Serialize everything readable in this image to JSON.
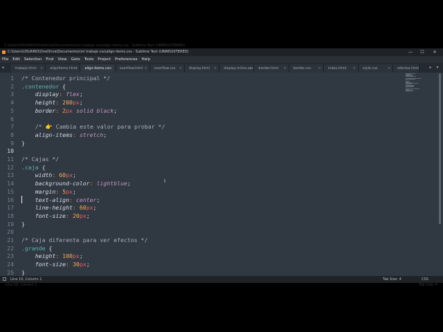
{
  "ghost": {
    "top_text": "C:\\Users\\USUARIO\\OneDrive\\Documentos\\mi trabajo css\\align-items.css - Sublime Text (UNREGISTERED)",
    "bottom_left": "Line 10, Column 1",
    "bottom_right": "Tab Size: 4"
  },
  "window": {
    "title": "C:\\Users\\USUARIO\\OneDrive\\Documentos\\mi trabajo css\\align-items.css - Sublime Text (UNREGISTERED)",
    "controls": {
      "minimize": "—",
      "maximize": "☐",
      "close": "✕"
    }
  },
  "menu": [
    "File",
    "Edit",
    "Selection",
    "Find",
    "View",
    "Goto",
    "Tools",
    "Project",
    "Preferences",
    "Help"
  ],
  "tabs": [
    {
      "label": "trabajo.html",
      "active": false
    },
    {
      "label": "alignItems.html",
      "active": false
    },
    {
      "label": "align-items.css",
      "active": true
    },
    {
      "label": "overflow.html",
      "active": false
    },
    {
      "label": "overflow.css",
      "active": false
    },
    {
      "label": "display.html",
      "active": false
    },
    {
      "label": "display-inline.css",
      "active": false
    },
    {
      "label": "border.html",
      "active": false
    },
    {
      "label": "border.css",
      "active": false
    },
    {
      "label": "index.html",
      "active": false
    },
    {
      "label": "style.css",
      "active": false
    },
    {
      "label": "efectos.html",
      "active": false
    }
  ],
  "tab_close": "×",
  "tab_arrows": {
    "left": "◂",
    "right": "▸",
    "more": "▾"
  },
  "editor": {
    "current_line": 10,
    "lines": [
      [
        [
          "cm",
          "/* Contenedor principal */"
        ]
      ],
      [
        [
          "sel",
          ".contenedor"
        ],
        [
          "br",
          " {"
        ]
      ],
      [
        [
          "ws",
          "    "
        ],
        [
          "prop",
          "display"
        ],
        [
          "colon",
          ":"
        ],
        [
          "ws",
          " "
        ],
        [
          "kw",
          "flex"
        ],
        [
          "semi",
          ";"
        ]
      ],
      [
        [
          "ws",
          "    "
        ],
        [
          "prop",
          "height"
        ],
        [
          "colon",
          ":"
        ],
        [
          "ws",
          " "
        ],
        [
          "num",
          "200"
        ],
        [
          "unit",
          "px"
        ],
        [
          "semi",
          ";"
        ]
      ],
      [
        [
          "ws",
          "    "
        ],
        [
          "prop",
          "border"
        ],
        [
          "colon",
          ":"
        ],
        [
          "ws",
          " "
        ],
        [
          "num",
          "2"
        ],
        [
          "unit",
          "px"
        ],
        [
          "ws",
          " "
        ],
        [
          "kw",
          "solid"
        ],
        [
          "ws",
          " "
        ],
        [
          "kw",
          "black"
        ],
        [
          "semi",
          ";"
        ]
      ],
      [],
      [
        [
          "ws",
          "    "
        ],
        [
          "cm",
          "/* "
        ],
        [
          "emoji",
          "👉"
        ],
        [
          "cm",
          " Cambia este valor para probar */"
        ]
      ],
      [
        [
          "ws",
          "    "
        ],
        [
          "prop",
          "align-items"
        ],
        [
          "colon",
          ":"
        ],
        [
          "ws",
          " "
        ],
        [
          "kw",
          "stretch"
        ],
        [
          "semi",
          ";"
        ]
      ],
      [
        [
          "br",
          "}"
        ]
      ],
      [],
      [
        [
          "cm",
          "/* Cajas */"
        ]
      ],
      [
        [
          "sel",
          ".caja"
        ],
        [
          "br",
          " {"
        ]
      ],
      [
        [
          "ws",
          "    "
        ],
        [
          "prop",
          "width"
        ],
        [
          "colon",
          ":"
        ],
        [
          "ws",
          " "
        ],
        [
          "num",
          "60"
        ],
        [
          "unit",
          "px"
        ],
        [
          "semi",
          ";"
        ]
      ],
      [
        [
          "ws",
          "    "
        ],
        [
          "prop",
          "background-color"
        ],
        [
          "colon",
          ":"
        ],
        [
          "ws",
          " "
        ],
        [
          "kw",
          "lightblue"
        ],
        [
          "semi",
          ";"
        ]
      ],
      [
        [
          "ws",
          "    "
        ],
        [
          "prop",
          "margin"
        ],
        [
          "colon",
          ":"
        ],
        [
          "ws",
          " "
        ],
        [
          "num",
          "5"
        ],
        [
          "unit",
          "px"
        ],
        [
          "semi",
          ";"
        ]
      ],
      [
        [
          "ws",
          "    "
        ],
        [
          "prop",
          "text-align"
        ],
        [
          "colon",
          ":"
        ],
        [
          "ws",
          " "
        ],
        [
          "kw",
          "center"
        ],
        [
          "semi",
          ";"
        ]
      ],
      [
        [
          "ws",
          "    "
        ],
        [
          "prop",
          "line-height"
        ],
        [
          "colon",
          ":"
        ],
        [
          "ws",
          " "
        ],
        [
          "num",
          "60"
        ],
        [
          "unit",
          "px"
        ],
        [
          "semi",
          ";"
        ]
      ],
      [
        [
          "ws",
          "    "
        ],
        [
          "prop",
          "font-size"
        ],
        [
          "colon",
          ":"
        ],
        [
          "ws",
          " "
        ],
        [
          "num",
          "20"
        ],
        [
          "unit",
          "px"
        ],
        [
          "semi",
          ";"
        ]
      ],
      [
        [
          "br",
          "}"
        ]
      ],
      [],
      [
        [
          "cm",
          "/* Caja diferente para ver efectos */"
        ]
      ],
      [
        [
          "sel",
          ".grande"
        ],
        [
          "br",
          " {"
        ]
      ],
      [
        [
          "ws",
          "    "
        ],
        [
          "prop",
          "height"
        ],
        [
          "colon",
          ":"
        ],
        [
          "ws",
          " "
        ],
        [
          "num",
          "100"
        ],
        [
          "unit",
          "px"
        ],
        [
          "semi",
          ";"
        ]
      ],
      [
        [
          "ws",
          "    "
        ],
        [
          "prop",
          "font-size"
        ],
        [
          "colon",
          ":"
        ],
        [
          "ws",
          " "
        ],
        [
          "num",
          "30"
        ],
        [
          "unit",
          "px"
        ],
        [
          "semi",
          ";"
        ]
      ],
      [
        [
          "br",
          "}"
        ]
      ]
    ]
  },
  "status": {
    "position": "Line 10, Column 1",
    "tab_size": "Tab Size: 4",
    "syntax": "CSS"
  }
}
